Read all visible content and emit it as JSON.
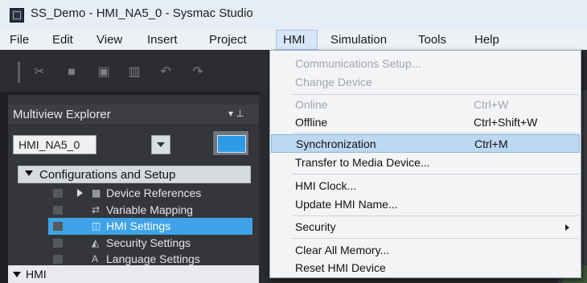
{
  "window": {
    "title": "SS_Demo - HMI_NA5_0 - Sysmac Studio"
  },
  "menubar": {
    "items": [
      "File",
      "Edit",
      "View",
      "Insert",
      "Project",
      "HMI",
      "Simulation",
      "Tools",
      "Help"
    ],
    "active": "HMI"
  },
  "toolbar": {
    "icons": [
      "cut-icon",
      "copy-icon",
      "paste-icon",
      "delete-icon",
      "undo-icon",
      "redo-icon"
    ]
  },
  "explorer": {
    "title": "Multiview Explorer",
    "header_controls": "▾ ⊥",
    "device_selector": "HMI_NA5_0",
    "section": "Configurations and Setup",
    "tree": [
      {
        "label": "Device References",
        "icon": "device-references-icon",
        "expandable": true,
        "selected": false
      },
      {
        "label": "Variable Mapping",
        "icon": "variable-mapping-icon",
        "expandable": false,
        "selected": false
      },
      {
        "label": "HMI Settings",
        "icon": "hmi-settings-icon",
        "expandable": false,
        "selected": true
      },
      {
        "label": "Security Settings",
        "icon": "security-settings-icon",
        "expandable": false,
        "selected": false
      },
      {
        "label": "Language Settings",
        "icon": "language-settings-icon",
        "expandable": false,
        "selected": false
      }
    ],
    "next_section": "HMI"
  },
  "hmi_menu": {
    "items": [
      {
        "label": "Communications Setup...",
        "shortcut": "",
        "disabled": true
      },
      {
        "label": "Change Device",
        "shortcut": "",
        "disabled": true
      },
      {
        "label": "Online",
        "shortcut": "Ctrl+W",
        "disabled": true
      },
      {
        "label": "Offline",
        "shortcut": "Ctrl+Shift+W",
        "disabled": false
      },
      {
        "label": "Synchronization",
        "shortcut": "Ctrl+M",
        "disabled": false,
        "highlighted": true
      },
      {
        "label": "Transfer to Media Device...",
        "shortcut": "",
        "disabled": false
      },
      {
        "label": "HMI Clock...",
        "shortcut": "",
        "disabled": false
      },
      {
        "label": "Update HMI Name...",
        "shortcut": "",
        "disabled": false
      },
      {
        "label": "Security",
        "shortcut": "",
        "disabled": false,
        "submenu": true
      },
      {
        "label": "Clear All Memory...",
        "shortcut": "",
        "disabled": false
      },
      {
        "label": "Reset HMI Device",
        "shortcut": "",
        "disabled": false
      }
    ]
  },
  "colors": {
    "selection_blue": "#3ea3e8",
    "menu_highlight": "#bcd8f3",
    "disabled_text": "#a2a6ab"
  }
}
